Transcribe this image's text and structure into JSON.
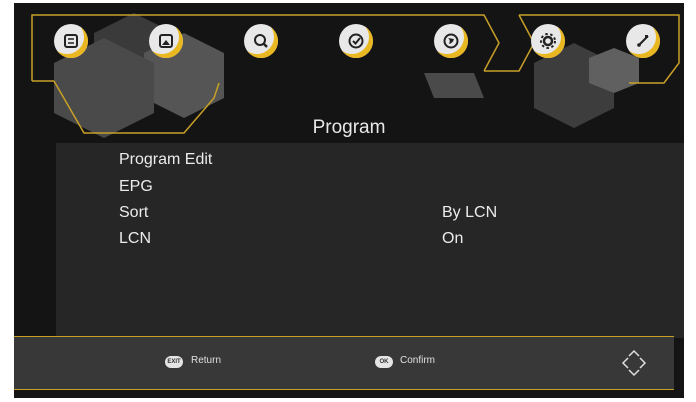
{
  "menu": {
    "icons": [
      {
        "name": "program-menu-icon",
        "symbol": "list"
      },
      {
        "name": "picture-menu-icon",
        "symbol": "picture"
      },
      {
        "name": "search-menu-icon",
        "symbol": "search"
      },
      {
        "name": "time-menu-icon",
        "symbol": "clock"
      },
      {
        "name": "option-menu-icon",
        "symbol": "globe"
      },
      {
        "name": "system-menu-icon",
        "symbol": "gear"
      },
      {
        "name": "usb-menu-icon",
        "symbol": "usb"
      }
    ],
    "active_icon": "program-menu-icon"
  },
  "page": {
    "title": "Program",
    "items": [
      {
        "label": "Program Edit",
        "value": ""
      },
      {
        "label": "EPG",
        "value": ""
      },
      {
        "label": "Sort",
        "value": "By LCN"
      },
      {
        "label": "LCN",
        "value": "On"
      }
    ]
  },
  "footer": {
    "exit_key": "EXIT",
    "return_label": "Return",
    "ok_key": "OK",
    "confirm_label": "Confirm",
    "nav_icon": "dpad-icon"
  },
  "colors": {
    "accent": "#e9b821",
    "background": "#141414",
    "footer": "#383838"
  }
}
